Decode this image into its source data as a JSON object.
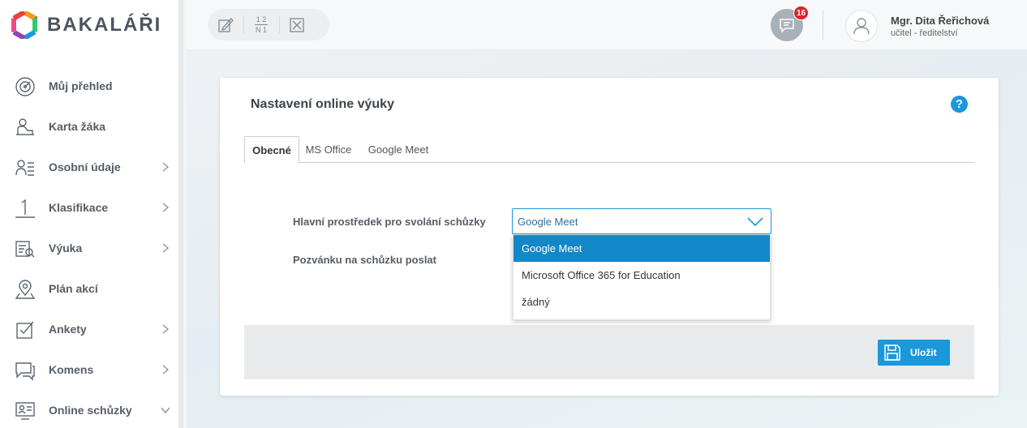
{
  "app": {
    "logo_text": "BAKALÁŘI"
  },
  "sidebar": {
    "items": [
      {
        "label": "Můj přehled",
        "icon": "dashboard-icon",
        "has_chevron": false
      },
      {
        "label": "Karta žáka",
        "icon": "student-icon",
        "has_chevron": false
      },
      {
        "label": "Osobní údaje",
        "icon": "personal-data-icon",
        "has_chevron": true
      },
      {
        "label": "Klasifikace",
        "icon": "grade-icon",
        "has_chevron": true
      },
      {
        "label": "Výuka",
        "icon": "teaching-icon",
        "has_chevron": true
      },
      {
        "label": "Plán akcí",
        "icon": "map-pin-icon",
        "has_chevron": false
      },
      {
        "label": "Ankety",
        "icon": "checkbox-icon",
        "has_chevron": true
      },
      {
        "label": "Komens",
        "icon": "chat-icon",
        "has_chevron": true
      },
      {
        "label": "Online schůzky",
        "icon": "online-meeting-icon",
        "has_chevron": true,
        "expanded": true
      }
    ]
  },
  "topbar": {
    "tools": [
      {
        "icon": "edit-icon"
      },
      {
        "icon": "grades-fraction-icon",
        "text_top": "1 2",
        "text_bottom": "N 1"
      },
      {
        "icon": "close-box-icon"
      }
    ],
    "messages_badge": "16",
    "user_name": "Mgr. Dita Řeřichová",
    "user_role": "učitel - ředitelství"
  },
  "page": {
    "title": "Nastavení online výuky",
    "help_label": "?",
    "tabs": [
      {
        "label": "Obecné",
        "active": true
      },
      {
        "label": "MS Office",
        "active": false
      },
      {
        "label": "Google Meet",
        "active": false
      }
    ],
    "form": {
      "field1_label": "Hlavní prostředek pro svolání schůzky",
      "field1_value": "Google Meet",
      "field2_label": "Pozvánku na schůzku poslat"
    },
    "dropdown_options": [
      {
        "label": "Google Meet",
        "selected": true
      },
      {
        "label": "Microsoft Office 365 for Education",
        "selected": false
      },
      {
        "label": "žádný",
        "selected": false
      }
    ],
    "save_label": "Uložit"
  },
  "colors": {
    "accent": "#1a98dc",
    "badge": "#d9232e"
  }
}
